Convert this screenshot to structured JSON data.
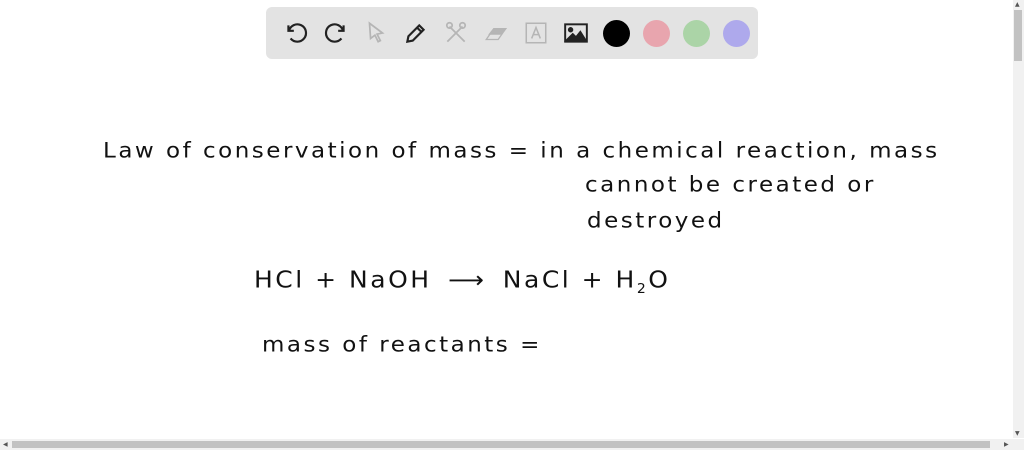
{
  "toolbar": {
    "tools": [
      "undo-icon",
      "redo-icon",
      "select-icon",
      "pen-icon",
      "tools-icon",
      "eraser-icon",
      "text-icon",
      "image-icon"
    ],
    "colors": [
      "#000000",
      "#e8a5ae",
      "#abd4a7",
      "#aea9ec"
    ]
  },
  "canvas": {
    "line1": "Law of conservation of mass = in a chemical reaction, mass",
    "line2": "cannot be created or",
    "line3": "destroyed",
    "equation_left": "HCl + NaOH",
    "equation_arrow": "⟶",
    "equation_right_a": "NaCl + H",
    "equation_sub": "2",
    "equation_right_b": "O",
    "line5": "mass of reactants ="
  }
}
